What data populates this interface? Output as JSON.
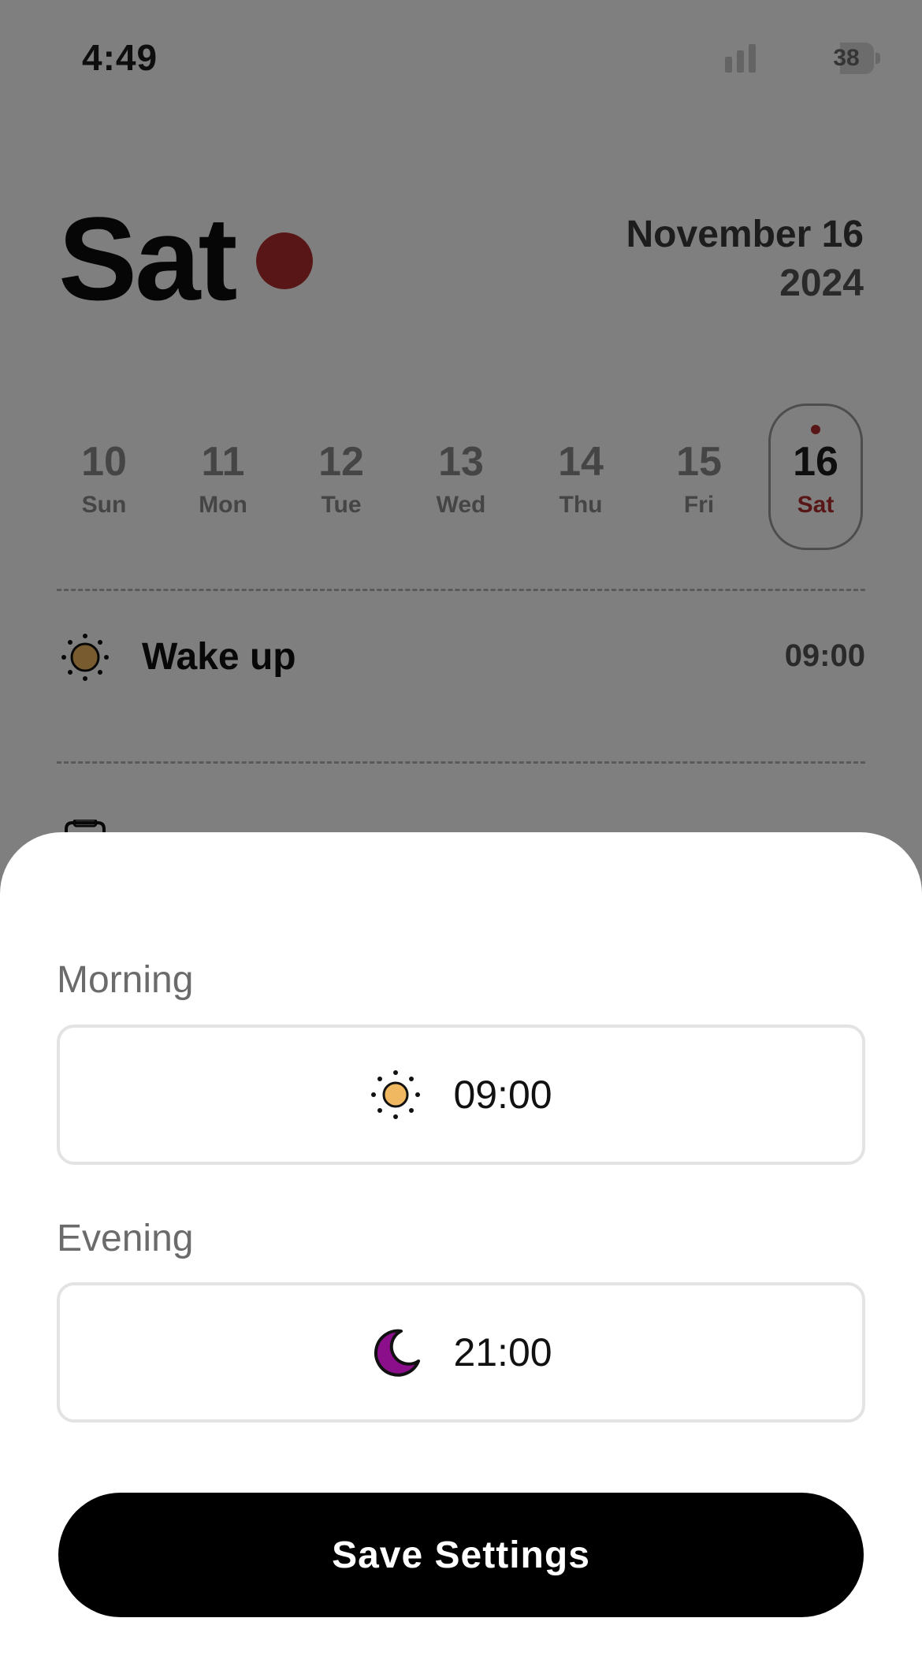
{
  "status_bar": {
    "time": "4:49",
    "battery_level": "38"
  },
  "header": {
    "day": "Sat",
    "month_day": "November 16",
    "year": "2024",
    "accent_color": "#b02e2c"
  },
  "week": {
    "days": [
      {
        "num": "10",
        "name": "Sun"
      },
      {
        "num": "11",
        "name": "Mon"
      },
      {
        "num": "12",
        "name": "Tue"
      },
      {
        "num": "13",
        "name": "Wed"
      },
      {
        "num": "14",
        "name": "Thu"
      },
      {
        "num": "15",
        "name": "Fri"
      },
      {
        "num": "16",
        "name": "Sat",
        "selected": true
      }
    ]
  },
  "schedule": {
    "wake": {
      "icon": "sun-icon",
      "label": "Wake up",
      "time": "09:00"
    }
  },
  "sheet": {
    "morning": {
      "label": "Morning",
      "value": "09:00",
      "icon": "sun-icon",
      "icon_color": "#f0b860"
    },
    "evening": {
      "label": "Evening",
      "value": "21:00",
      "icon": "moon-icon",
      "icon_color": "#8b0f8b"
    },
    "save_label": "Save Settings"
  }
}
